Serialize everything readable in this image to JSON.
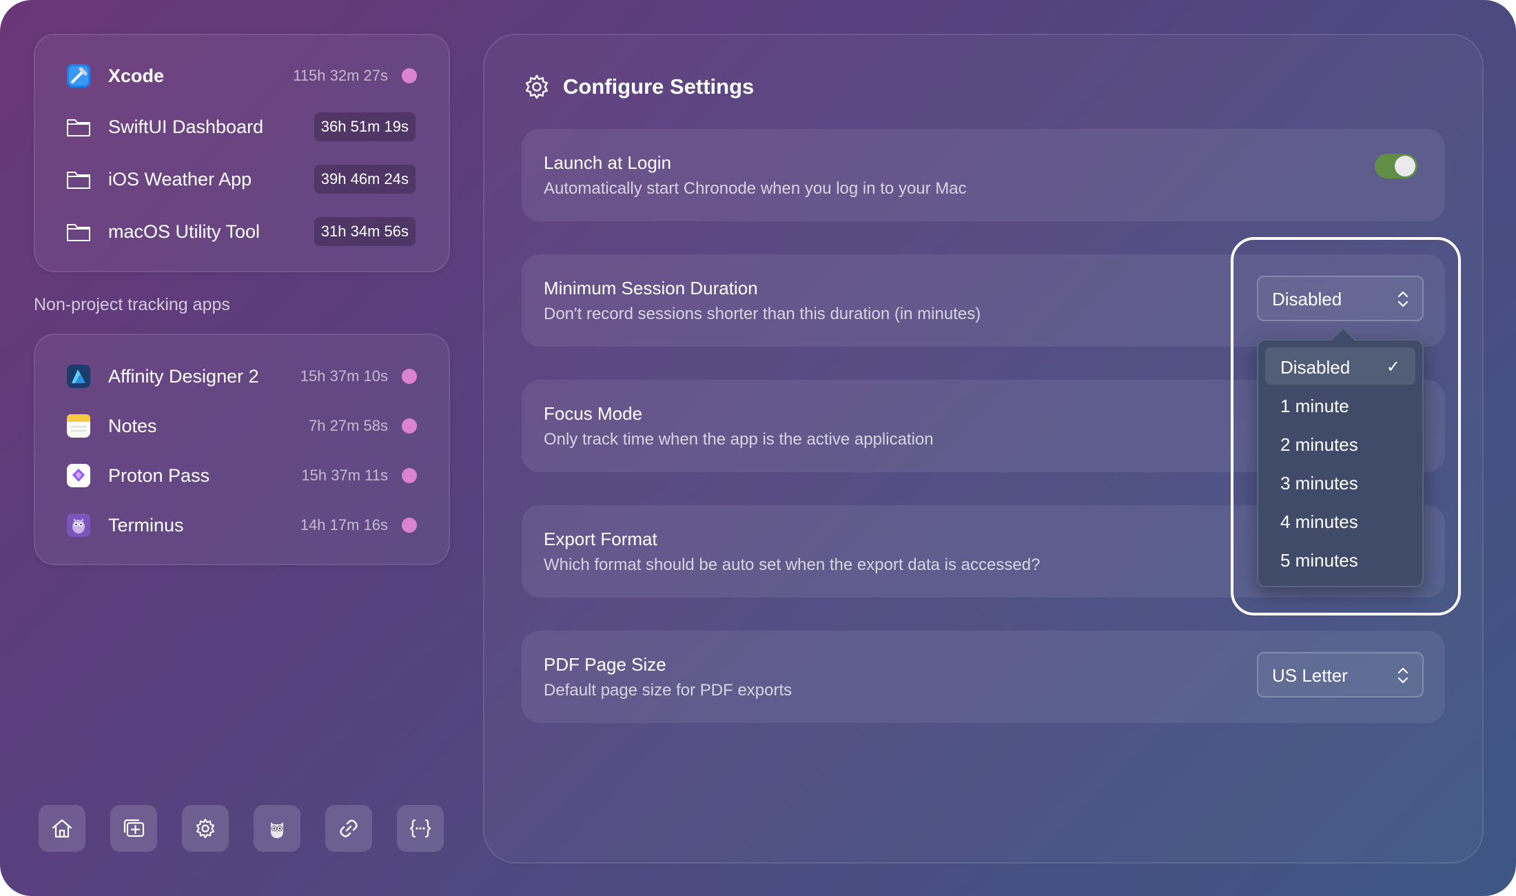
{
  "projects": [
    {
      "name": "Xcode",
      "time": "115h 32m 27s",
      "icon": "xcode-icon",
      "dot_color": "#d983d2"
    },
    {
      "name": "SwiftUI Dashboard",
      "time": "36h 51m 19s",
      "icon": "folder-icon"
    },
    {
      "name": "iOS Weather App",
      "time": "39h 46m 24s",
      "icon": "folder-icon"
    },
    {
      "name": "macOS Utility Tool",
      "time": "31h 34m 56s",
      "icon": "folder-icon"
    }
  ],
  "non_project_label": "Non-project tracking apps",
  "apps": [
    {
      "name": "Affinity Designer 2",
      "time": "15h 37m 10s",
      "icon": "affinity-designer-icon"
    },
    {
      "name": "Notes",
      "time": "7h 27m 58s",
      "icon": "notes-icon"
    },
    {
      "name": "Proton Pass",
      "time": "15h 37m 11s",
      "icon": "proton-pass-icon"
    },
    {
      "name": "Terminus",
      "time": "14h 17m 16s",
      "icon": "terminus-icon"
    }
  ],
  "toolbar": [
    "home-icon",
    "add-window-icon",
    "gear-icon",
    "owl-icon",
    "link-icon",
    "braces-icon"
  ],
  "settings_title": "Configure Settings",
  "settings": [
    {
      "title": "Launch at Login",
      "desc": "Automatically start Chronode when you log in to your Mac",
      "toggle_on": true
    },
    {
      "title": "Minimum Session Duration",
      "desc": "Don't record sessions shorter than this duration (in minutes)",
      "value": "Disabled"
    },
    {
      "title": "Focus Mode",
      "desc": "Only track time when the app is the active application"
    },
    {
      "title": "Export Format",
      "desc": "Which format should be auto set when the export data is accessed?"
    },
    {
      "title": "PDF Page Size",
      "desc": "Default page size for PDF exports",
      "value": "US Letter"
    }
  ],
  "dropdown": {
    "options": [
      "Disabled",
      "1 minute",
      "2 minutes",
      "3 minutes",
      "4 minutes",
      "5 minutes"
    ],
    "selected": "Disabled",
    "check": "✓"
  },
  "colors": {
    "accent_dot": "#d983d2",
    "toggle_on": "#5f8e44"
  }
}
